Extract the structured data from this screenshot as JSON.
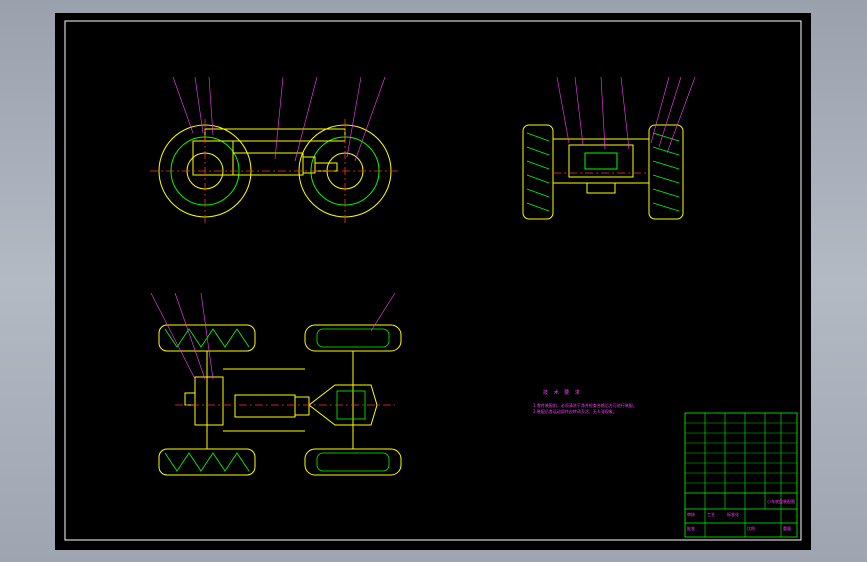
{
  "drawing": {
    "background": "#000000",
    "colors": {
      "frame": "#ffffff",
      "outline": "#ffff00",
      "detail": "#00ff00",
      "centerline": "#ff3030",
      "leader": "#ff3cff",
      "text": "#ff3cff"
    },
    "tech_notes": {
      "title": "技 术 要 求",
      "lines": [
        "1.零件装配前，必须清洗干净并检查合格后方可进行装配。",
        "2.装配后各运动部件应转动灵活，无卡滞现象。"
      ]
    },
    "title_block": {
      "drawing_name": "小车底盘装配图",
      "cells": [
        "审核",
        "工艺",
        "标准化",
        "批准",
        "比例",
        "重量"
      ]
    }
  }
}
